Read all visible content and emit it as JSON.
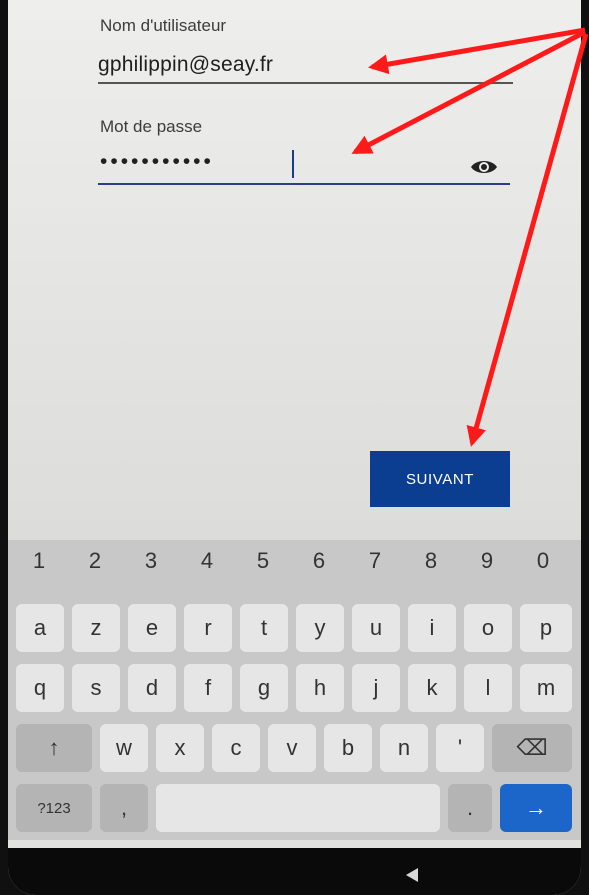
{
  "login": {
    "username_label": "Nom d'utilisateur",
    "username_value": "gphilippin@seay.fr",
    "password_label": "Mot de passe",
    "password_mask": "•••••••••••",
    "next_label": "SUIVANT"
  },
  "keyboard": {
    "numbers": [
      "1",
      "2",
      "3",
      "4",
      "5",
      "6",
      "7",
      "8",
      "9",
      "0"
    ],
    "row1": [
      "a",
      "z",
      "e",
      "r",
      "t",
      "y",
      "u",
      "i",
      "o",
      "p"
    ],
    "row2": [
      "q",
      "s",
      "d",
      "f",
      "g",
      "h",
      "j",
      "k",
      "l",
      "m"
    ],
    "row3": [
      "w",
      "x",
      "c",
      "v",
      "b",
      "n",
      "'"
    ],
    "shift_icon": "↑",
    "backspace_icon": "⌫",
    "symbols_label": "?123",
    "comma_label": ",",
    "period_label": ".",
    "enter_icon": "→"
  },
  "colors": {
    "accent": "#0b3d91",
    "annotation": "#ff1a1a",
    "enter_key": "#1d66c9"
  }
}
